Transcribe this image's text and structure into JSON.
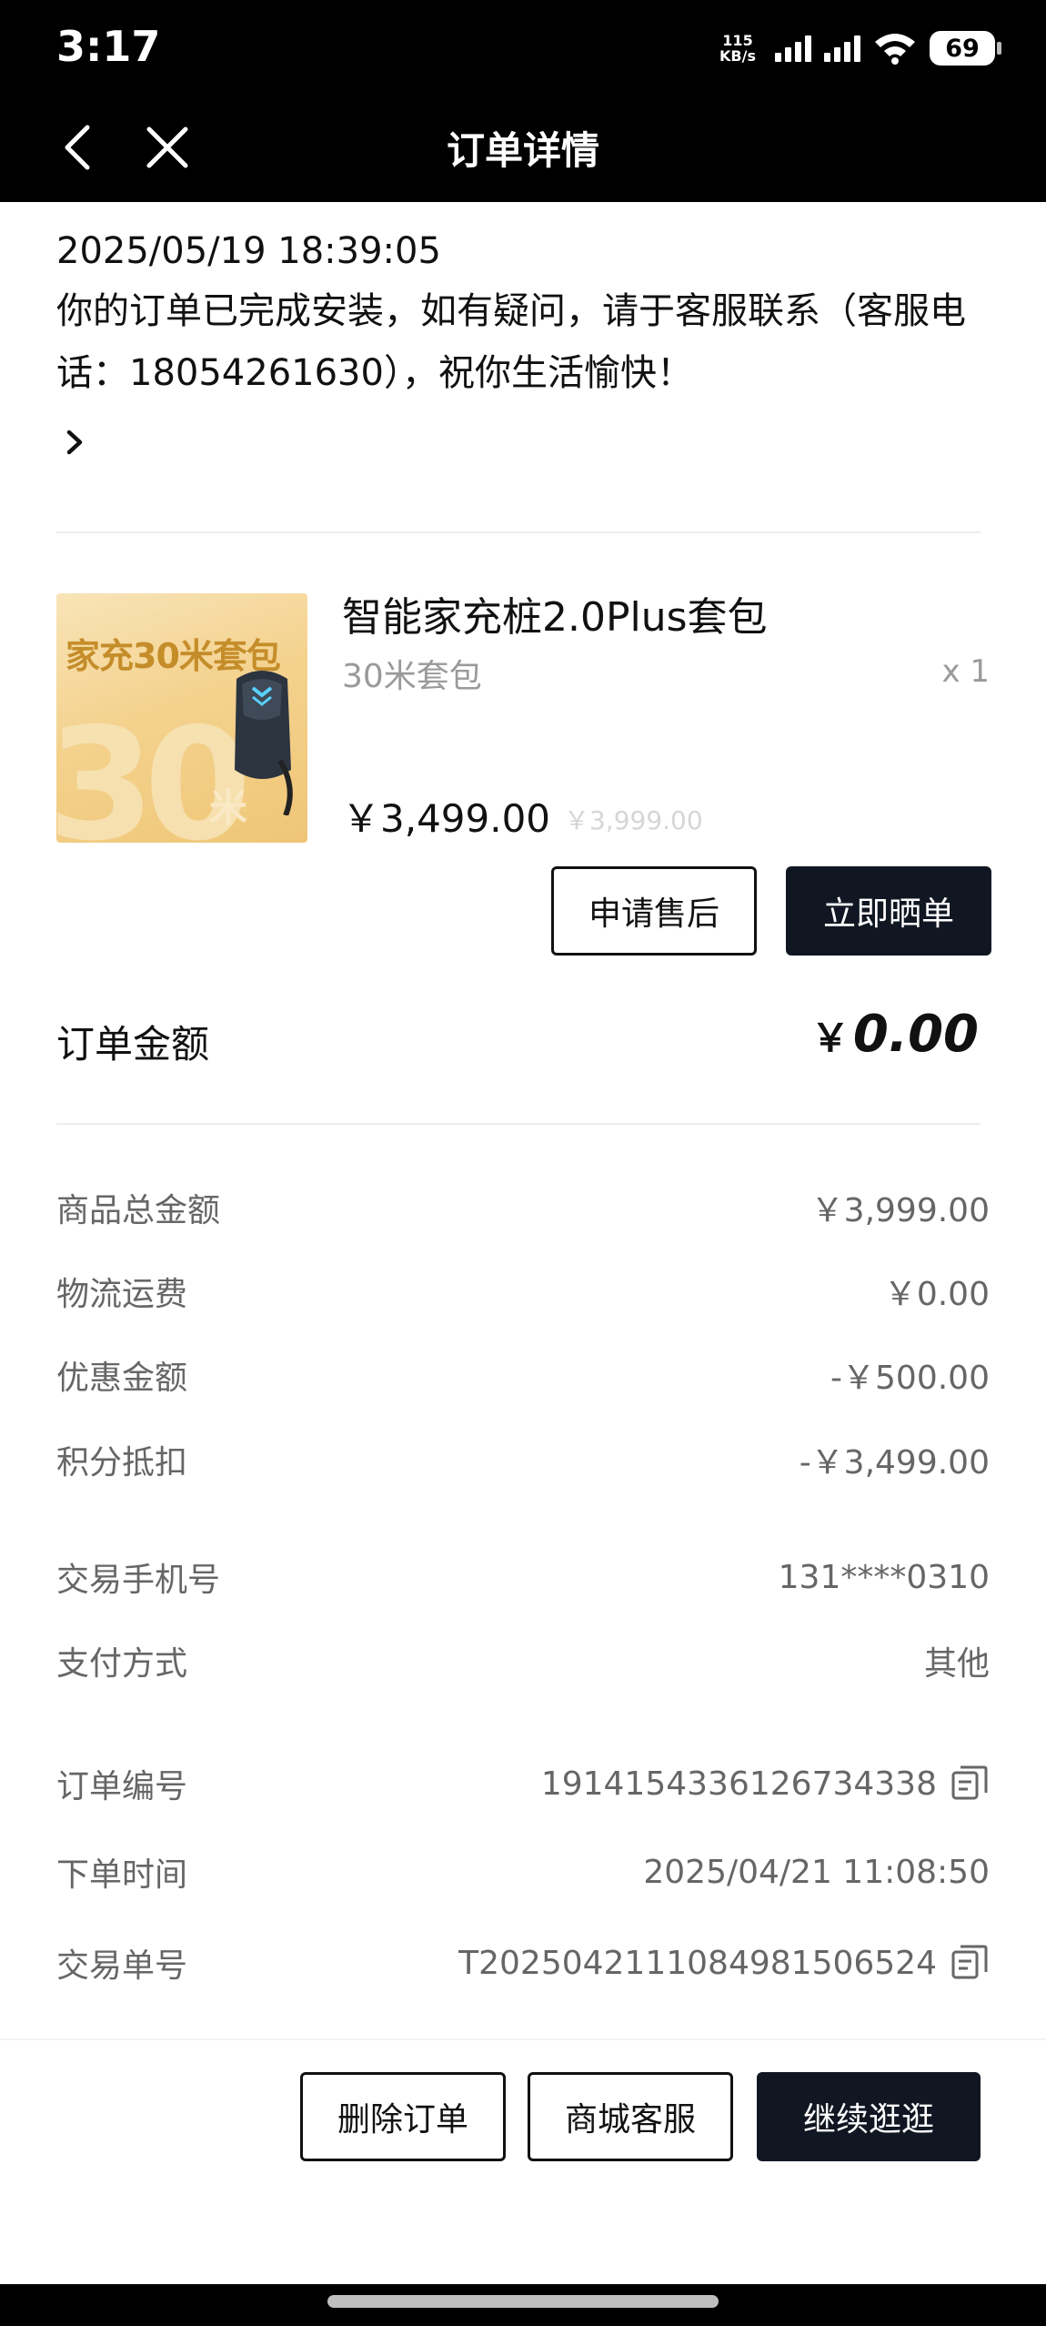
{
  "status_bar": {
    "time": "3:17",
    "net_speed_value": "115",
    "net_speed_unit": "KB/s",
    "battery": "69"
  },
  "nav": {
    "title": "订单详情"
  },
  "notice": {
    "timestamp": "2025/05/19 18:39:05",
    "message": "你的订单已完成安装，如有疑问，请于客服联系（客服电话：18054261630），祝你生活愉快！"
  },
  "product": {
    "image_title": "家充30米套包",
    "image_big": "30",
    "image_unit": "米",
    "name": "智能家充桩2.0Plus套包",
    "spec": "30米套包",
    "quantity": "x 1",
    "price": "￥3,499.00",
    "original_price": "￥3,999.00",
    "after_sale_label": "申请售后",
    "review_label": "立即晒单"
  },
  "order_amount": {
    "label": "订单金额",
    "currency": "￥",
    "value": "0.00"
  },
  "details": [
    {
      "label": "商品总金额",
      "value": "￥3,999.00",
      "copyable": false
    },
    {
      "label": "物流运费",
      "value": "￥0.00",
      "copyable": false
    },
    {
      "label": "优惠金额",
      "value": "-￥500.00",
      "copyable": false
    },
    {
      "label": "积分抵扣",
      "value": "-￥3,499.00",
      "copyable": false
    },
    {
      "label": "交易手机号",
      "value": "131****0310",
      "copyable": false
    },
    {
      "label": "支付方式",
      "value": "其他",
      "copyable": false
    },
    {
      "label": "订单编号",
      "value": "1914154336126734338",
      "copyable": true
    },
    {
      "label": "下单时间",
      "value": "2025/04/21 11:08:50",
      "copyable": false
    },
    {
      "label": "交易单号",
      "value": "T2025042111084981506524",
      "copyable": true
    }
  ],
  "actions": {
    "delete_label": "删除订单",
    "service_label": "商城客服",
    "continue_label": "继续逛逛"
  },
  "colors": {
    "dark_button": "#111722",
    "muted_text": "#9a9a9a"
  }
}
